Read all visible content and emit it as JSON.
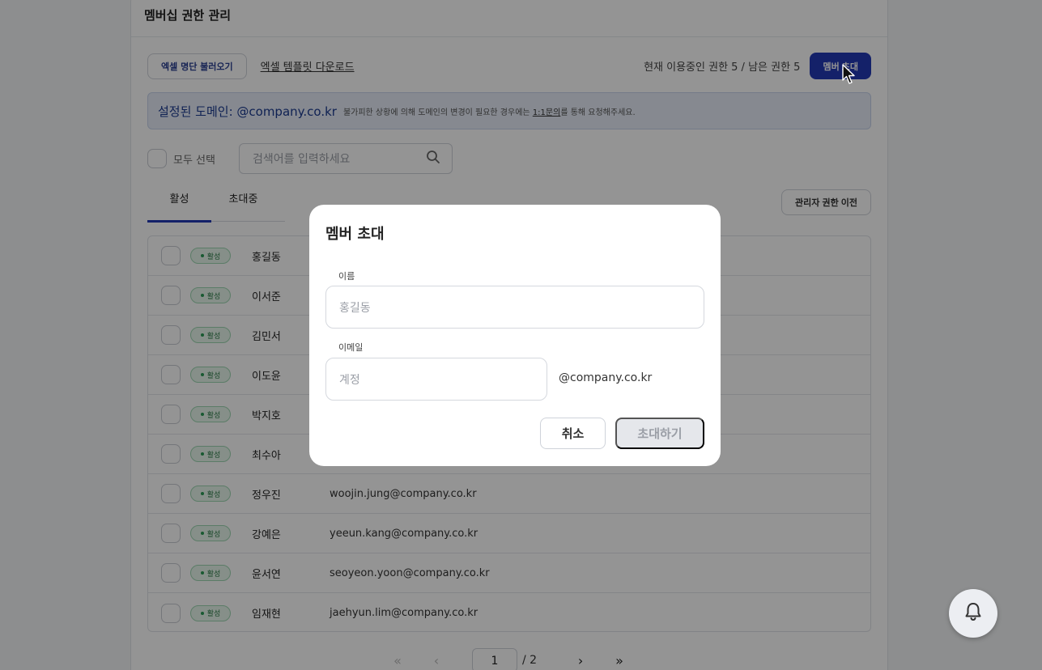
{
  "panel": {
    "title": "멤버십 권한 관리",
    "excel_load_label": "엑셀 명단 불러오기",
    "excel_template_label": "엑셀 템플릿 다운로드",
    "usage_text": "현재 이용중인 권한 5 / 남은 권한 5",
    "invite_member_label": "멤버 초대"
  },
  "domain_bar": {
    "main_text": "설정된 도메인: @company.co.kr",
    "note_before": "불가피한 상황에 의해 도메인의 변경이 필요한 경우에는",
    "note_link": "1:1문의",
    "note_after": "를 통해 요청해주세요."
  },
  "filter": {
    "select_all_label": "모두 선택",
    "search_placeholder": "검색어를 입력하세요"
  },
  "tabs": [
    {
      "label": "활성",
      "active": true
    },
    {
      "label": "초대중",
      "active": false
    }
  ],
  "admin_transfer_label": "관리자 권한 이전",
  "members": [
    {
      "status": "활성",
      "name": "홍길동",
      "email": ""
    },
    {
      "status": "활성",
      "name": "이서준",
      "email": ""
    },
    {
      "status": "활성",
      "name": "김민서",
      "email": ""
    },
    {
      "status": "활성",
      "name": "이도윤",
      "email": ""
    },
    {
      "status": "활성",
      "name": "박지호",
      "email": ""
    },
    {
      "status": "활성",
      "name": "최수아",
      "email": ""
    },
    {
      "status": "활성",
      "name": "정우진",
      "email": "woojin.jung@company.co.kr"
    },
    {
      "status": "활성",
      "name": "강예은",
      "email": "yeeun.kang@company.co.kr"
    },
    {
      "status": "활성",
      "name": "윤서연",
      "email": "seoyeon.yoon@company.co.kr"
    },
    {
      "status": "활성",
      "name": "임재현",
      "email": "jaehyun.lim@company.co.kr"
    }
  ],
  "pagination": {
    "current": "1",
    "total": "/ 2"
  },
  "modal": {
    "title": "멤버 초대",
    "name_label": "이름",
    "name_placeholder": "홍길동",
    "email_label": "이메일",
    "email_placeholder": "계정",
    "domain_suffix": "@company.co.kr",
    "cancel_label": "취소",
    "invite_label": "초대하기"
  },
  "colors": {
    "primary": "#2339b6",
    "badge_bg": "#e7f6ec",
    "badge_text": "#2a7a45",
    "domain_bar_bg": "#e7edf8"
  }
}
